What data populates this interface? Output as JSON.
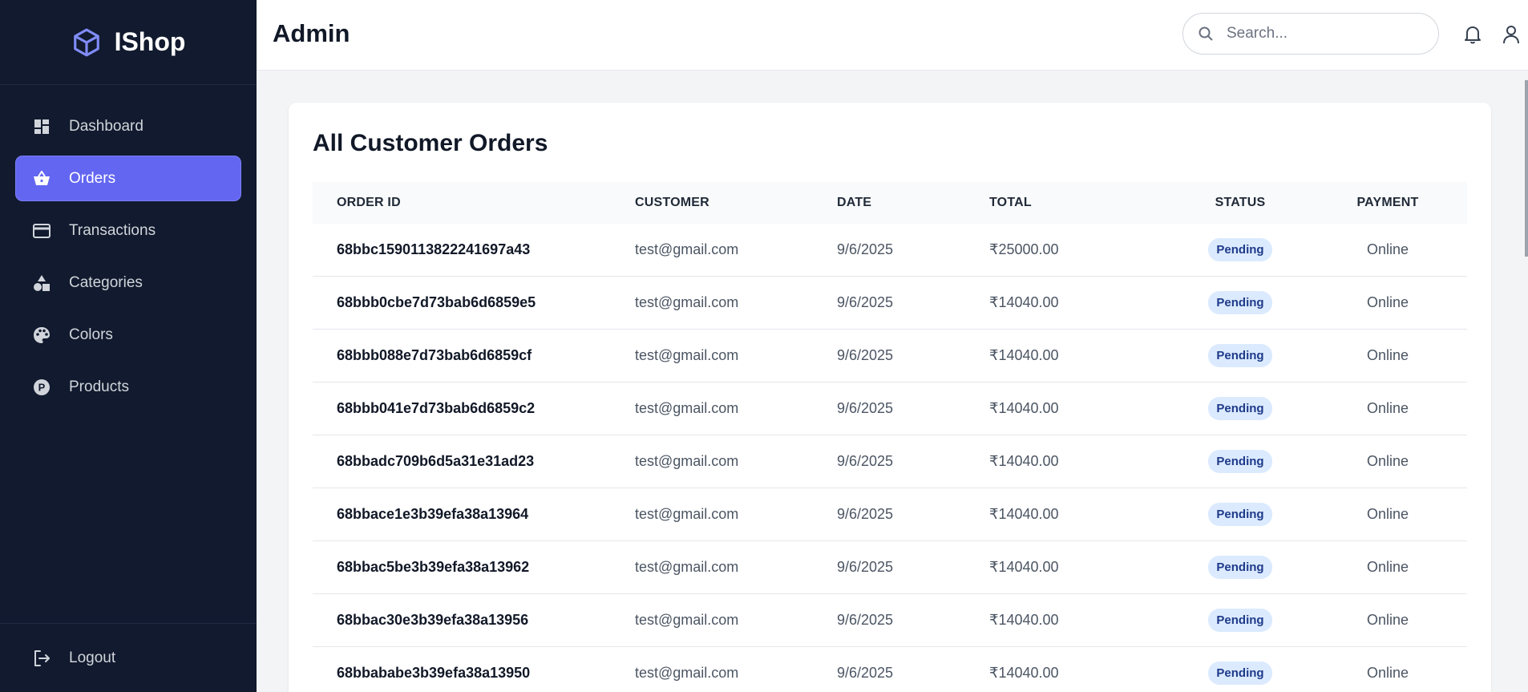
{
  "brand": {
    "name": "IShop",
    "accent": "#6366f1"
  },
  "sidebar": {
    "items": [
      {
        "label": "Dashboard",
        "icon": "dashboard-icon",
        "active": false
      },
      {
        "label": "Orders",
        "icon": "basket-icon",
        "active": true
      },
      {
        "label": "Transactions",
        "icon": "credit-card-icon",
        "active": false
      },
      {
        "label": "Categories",
        "icon": "shapes-icon",
        "active": false
      },
      {
        "label": "Colors",
        "icon": "palette-icon",
        "active": false
      },
      {
        "label": "Products",
        "icon": "product-p-icon",
        "active": false
      }
    ],
    "logout_label": "Logout"
  },
  "header": {
    "title": "Admin",
    "search_placeholder": "Search...",
    "icons": [
      "bell-icon",
      "user-icon"
    ]
  },
  "orders": {
    "title": "All Customer Orders",
    "columns": [
      "ORDER ID",
      "CUSTOMER",
      "DATE",
      "TOTAL",
      "STATUS",
      "PAYMENT"
    ],
    "rows": [
      {
        "id": "68bbc1590113822241697a43",
        "customer": "test@gmail.com",
        "date": "9/6/2025",
        "total": "₹25000.00",
        "status": "Pending",
        "payment": "Online"
      },
      {
        "id": "68bbb0cbe7d73bab6d6859e5",
        "customer": "test@gmail.com",
        "date": "9/6/2025",
        "total": "₹14040.00",
        "status": "Pending",
        "payment": "Online"
      },
      {
        "id": "68bbb088e7d73bab6d6859cf",
        "customer": "test@gmail.com",
        "date": "9/6/2025",
        "total": "₹14040.00",
        "status": "Pending",
        "payment": "Online"
      },
      {
        "id": "68bbb041e7d73bab6d6859c2",
        "customer": "test@gmail.com",
        "date": "9/6/2025",
        "total": "₹14040.00",
        "status": "Pending",
        "payment": "Online"
      },
      {
        "id": "68bbadc709b6d5a31e31ad23",
        "customer": "test@gmail.com",
        "date": "9/6/2025",
        "total": "₹14040.00",
        "status": "Pending",
        "payment": "Online"
      },
      {
        "id": "68bbace1e3b39efa38a13964",
        "customer": "test@gmail.com",
        "date": "9/6/2025",
        "total": "₹14040.00",
        "status": "Pending",
        "payment": "Online"
      },
      {
        "id": "68bbac5be3b39efa38a13962",
        "customer": "test@gmail.com",
        "date": "9/6/2025",
        "total": "₹14040.00",
        "status": "Pending",
        "payment": "Online"
      },
      {
        "id": "68bbac30e3b39efa38a13956",
        "customer": "test@gmail.com",
        "date": "9/6/2025",
        "total": "₹14040.00",
        "status": "Pending",
        "payment": "Online"
      },
      {
        "id": "68bbababe3b39efa38a13950",
        "customer": "test@gmail.com",
        "date": "9/6/2025",
        "total": "₹14040.00",
        "status": "Pending",
        "payment": "Online"
      }
    ]
  }
}
